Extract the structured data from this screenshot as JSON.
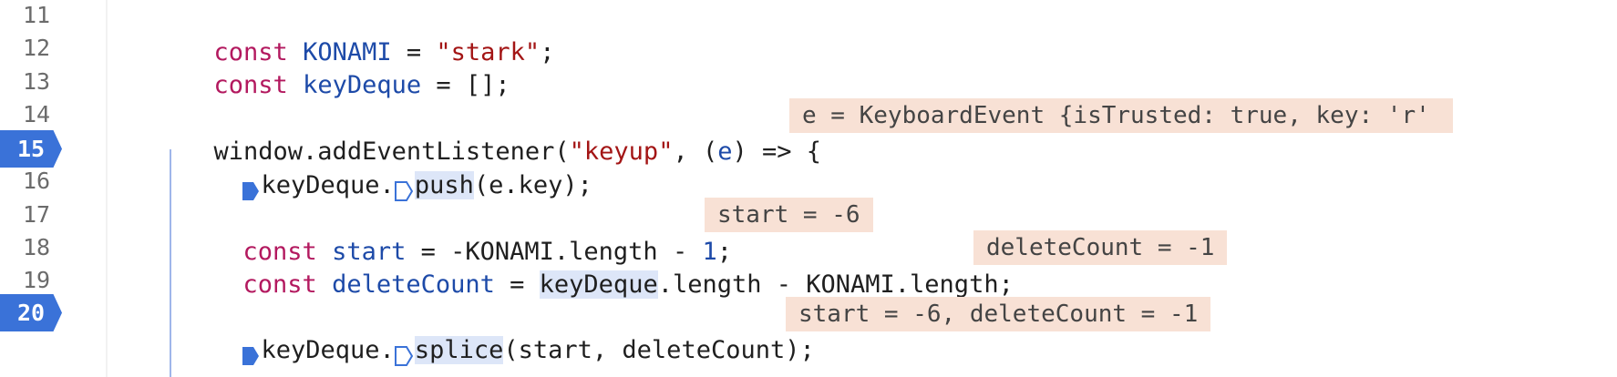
{
  "gutter": {
    "line_numbers": [
      "11",
      "12",
      "13",
      "14",
      "15",
      "16",
      "17",
      "18",
      "19",
      "20"
    ],
    "breakpoint_lines": [
      "15",
      "20"
    ]
  },
  "code": {
    "l11": {
      "kw": "const",
      "name": "KONAMI",
      "eq": " = ",
      "str": "\"stark\"",
      "end": ";"
    },
    "l12": {
      "kw": "const",
      "name": "keyDeque",
      "rest": " = [];"
    },
    "l14": {
      "a": "window.addEventListener(",
      "str": "\"keyup\"",
      "b": ", (",
      "param": "e",
      "c": ") => {"
    },
    "l15": {
      "a": "keyDeque.",
      "method": "push",
      "b": "(e.key);"
    },
    "l17": {
      "kw": "const",
      "name": "start",
      "a": " = -KONAMI.length - ",
      "num": "1",
      "b": ";"
    },
    "l18": {
      "kw": "const",
      "name": "deleteCount",
      "a": " = ",
      "hlvar": "keyDeque",
      "b": ".length - KONAMI.length;"
    },
    "l20": {
      "a": "keyDeque.",
      "method": "splice",
      "b": "(start, deleteCount);"
    }
  },
  "inline_previews": {
    "l14": "e = KeyboardEvent {isTrusted: true, key: 'r'",
    "l17": "start = -6",
    "l18": "deleteCount = -1",
    "l20": "start = -6, deleteCount = -1"
  },
  "colors": {
    "keyword": "#b3195f",
    "identifier": "#1d4aa8",
    "string": "#a31515",
    "breakpoint": "#3a72d8",
    "inline_preview_bg": "#f8e1d5"
  }
}
